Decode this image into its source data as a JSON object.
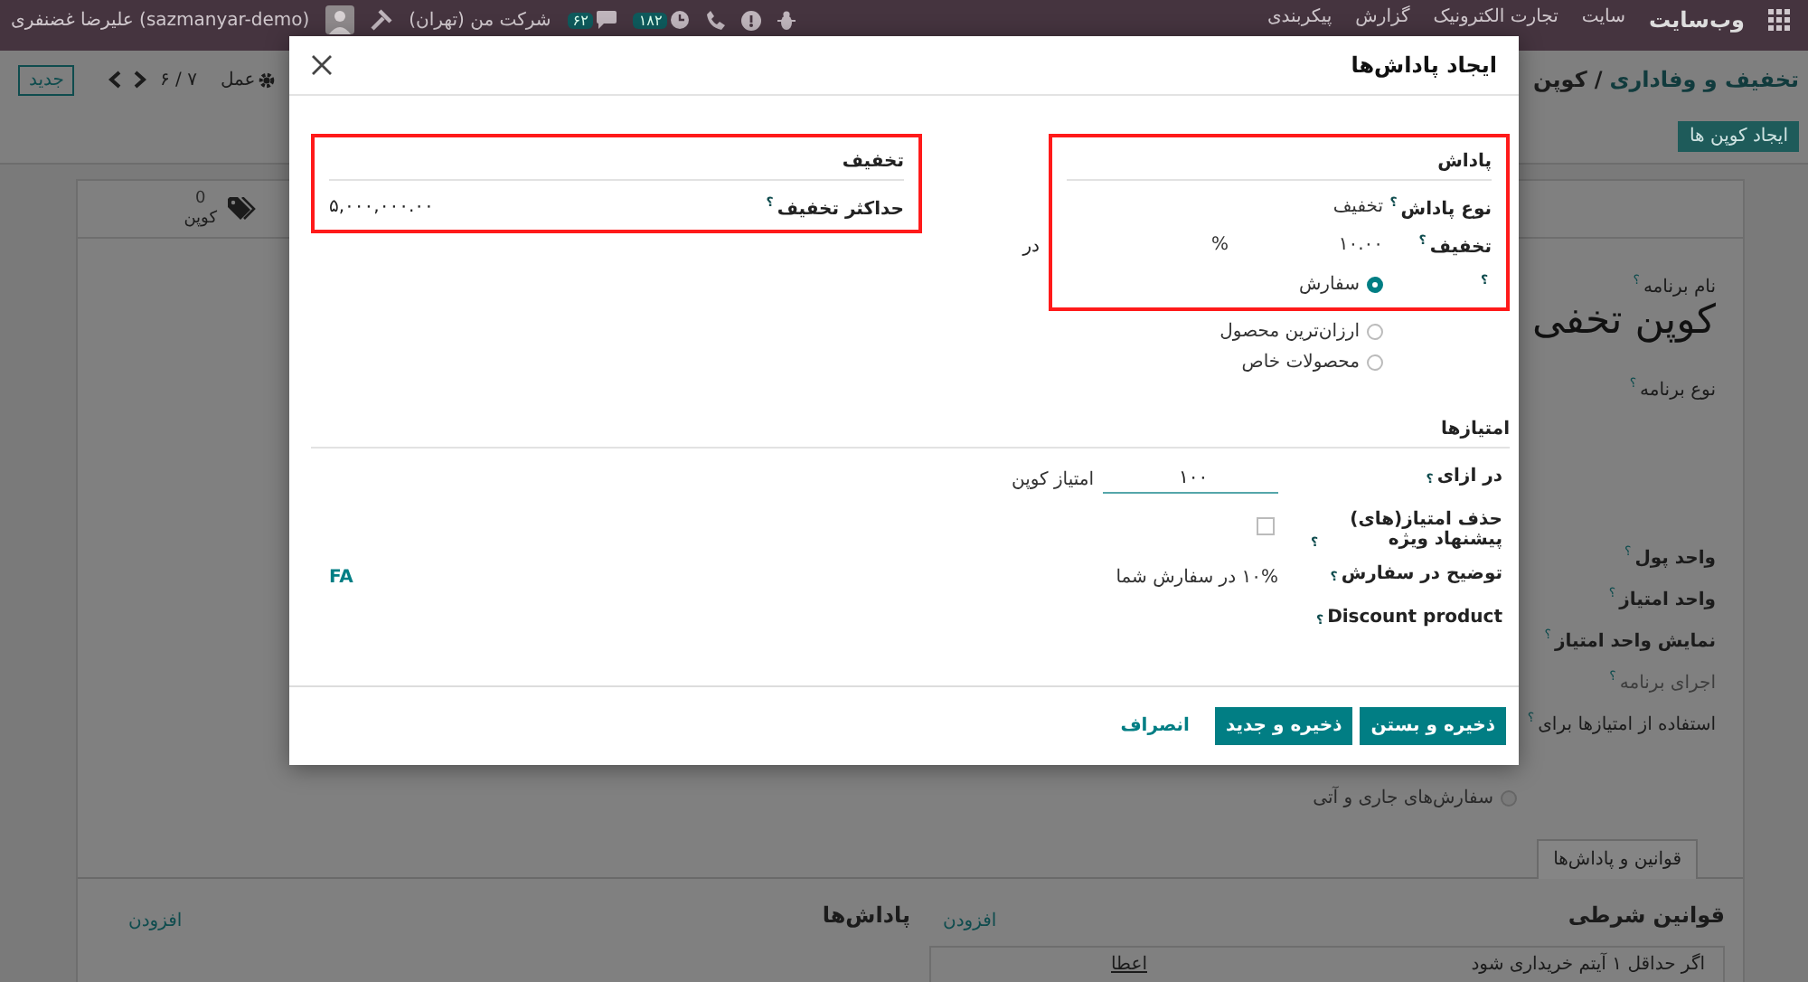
{
  "navbar": {
    "brand": "وب‌سایت",
    "menu": [
      "سایت",
      "تجارت الکترونیک",
      "گزارش",
      "پیکربندی"
    ],
    "counters": [
      {
        "count": "۱۸۲"
      },
      {
        "count": "۶۲"
      }
    ],
    "company": "شرکت من (تهران)",
    "user": "(sazmanyar-demo) علیرضا غضنفری"
  },
  "control_panel": {
    "breadcrumb": {
      "parent": "تخفیف و وفاداری",
      "separator": "/",
      "current": "کوپن"
    },
    "action": "عمل",
    "pager": "۷ / ۶",
    "new_button": "جدید",
    "create_button": "ایجاد کوپن ها"
  },
  "sheet": {
    "stat": {
      "value": "0",
      "label": "کوپن"
    },
    "top_fields": [
      {
        "label": "نام برنامه",
        "help": "؟",
        "bold": false
      }
    ],
    "title": "کوپن تخفی",
    "type_fields": [
      {
        "label": "نوع برنامه",
        "help": "؟",
        "bold": false
      }
    ],
    "fields": [
      {
        "label": "واحد پول",
        "help": "؟",
        "bold": true,
        "muted": false
      },
      {
        "label": "واحد امتیاز",
        "help": "؟",
        "bold": true,
        "muted": false
      },
      {
        "label": "نمایش واحد امتیاز",
        "help": "؟",
        "bold": true,
        "muted": false
      },
      {
        "label": "اجرای برنامه",
        "help": "؟",
        "bold": false,
        "muted": true
      },
      {
        "label": "استفاده از امتیازها برای",
        "help": "؟",
        "bold": false,
        "muted": false
      }
    ],
    "radio": {
      "label": "سفارش‌های جاری و آتی",
      "selected": false
    },
    "tabs": [
      {
        "label": "قوانین و پاداش‌ها",
        "selected": true
      }
    ],
    "rules": {
      "title": "قوانین شرطی",
      "add": "افزودن",
      "rows": [
        {
          "text": "اگر حداقل ۱ آیتم خریداری شود",
          "link": "اعطا"
        }
      ]
    },
    "rewards": {
      "title": "پاداش‌ها",
      "add": "افزودن"
    }
  },
  "dialog": {
    "title": "ایجاد پاداش‌ها",
    "reward_section": {
      "title": "پاداش",
      "fields": [
        {
          "label": "نوع پاداش",
          "help": "؟",
          "value": "تخفیف"
        },
        {
          "label": "تخفیف",
          "help": "؟",
          "value": "۱۰.۰۰",
          "unit": "%"
        }
      ],
      "suffix": "در",
      "apply_help": "؟",
      "apply_on": [
        {
          "label": "سفارش",
          "selected": true
        },
        {
          "label": "ارزان‌ترین محصول",
          "selected": false
        },
        {
          "label": "محصولات خاص",
          "selected": false
        }
      ]
    },
    "discount_section": {
      "title": "تخفیف",
      "fields": [
        {
          "label": "حداکثر تخفیف",
          "help": "؟",
          "value": "۵,۰۰۰,۰۰۰.۰۰"
        }
      ]
    },
    "points_section": {
      "title": "امتیازها",
      "rows": [
        {
          "kind": "input",
          "label": "در ازای",
          "help": "؟",
          "value": "۱۰۰",
          "unit": "امتیاز کوپن"
        },
        {
          "kind": "checkbox",
          "label": "حذف امتیاز(های) پیشنهاد ویژه",
          "help": "؟",
          "checked": false
        },
        {
          "kind": "text",
          "label": "توضیح در سفارش",
          "help": "؟",
          "value": "۱۰% در سفارش شما",
          "lang": "FA"
        },
        {
          "kind": "empty",
          "label": "Discount product",
          "help": "؟"
        }
      ]
    },
    "buttons": [
      {
        "label": "ذخیره و بستن",
        "kind": "primary"
      },
      {
        "label": "ذخیره و جدید",
        "kind": "primary"
      },
      {
        "label": "انصراف",
        "kind": "link"
      }
    ]
  }
}
